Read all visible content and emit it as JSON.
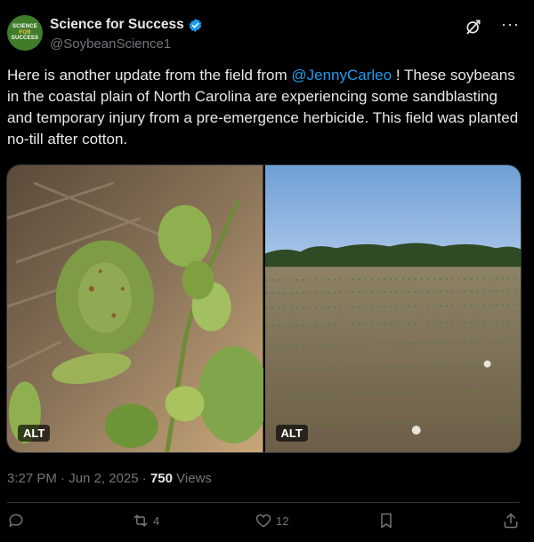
{
  "author": {
    "display_name": "Science for Success",
    "handle": "@SoybeanScience1",
    "avatar_lines": [
      "SCIENCE",
      "FOR",
      "SUCCESS"
    ]
  },
  "tweet": {
    "text_before": "Here is another update from the field from ",
    "mention": "@JennyCarleo",
    "text_after": " ! These soybeans in the coastal plain of North Carolina are experiencing some sandblasting and temporary injury from a pre-emergence herbicide. This field was planted no-till after cotton."
  },
  "media": [
    {
      "alt_label": "ALT"
    },
    {
      "alt_label": "ALT"
    }
  ],
  "meta": {
    "time": "3:27 PM",
    "sep": " · ",
    "date": "Jun 2, 2025",
    "views_count": "750",
    "views_label": " Views"
  },
  "actions": {
    "replies": "",
    "reposts": "4",
    "likes": "12"
  },
  "icons": {
    "verified": "verified-badge-icon",
    "grok": "grok-icon",
    "more": "more-options-icon",
    "reply": "reply-icon",
    "repost": "repost-icon",
    "like": "like-icon",
    "bookmark": "bookmark-icon",
    "share": "share-icon"
  },
  "colors": {
    "accent": "#1d9bf0",
    "background": "#000000",
    "muted": "#71767b"
  }
}
